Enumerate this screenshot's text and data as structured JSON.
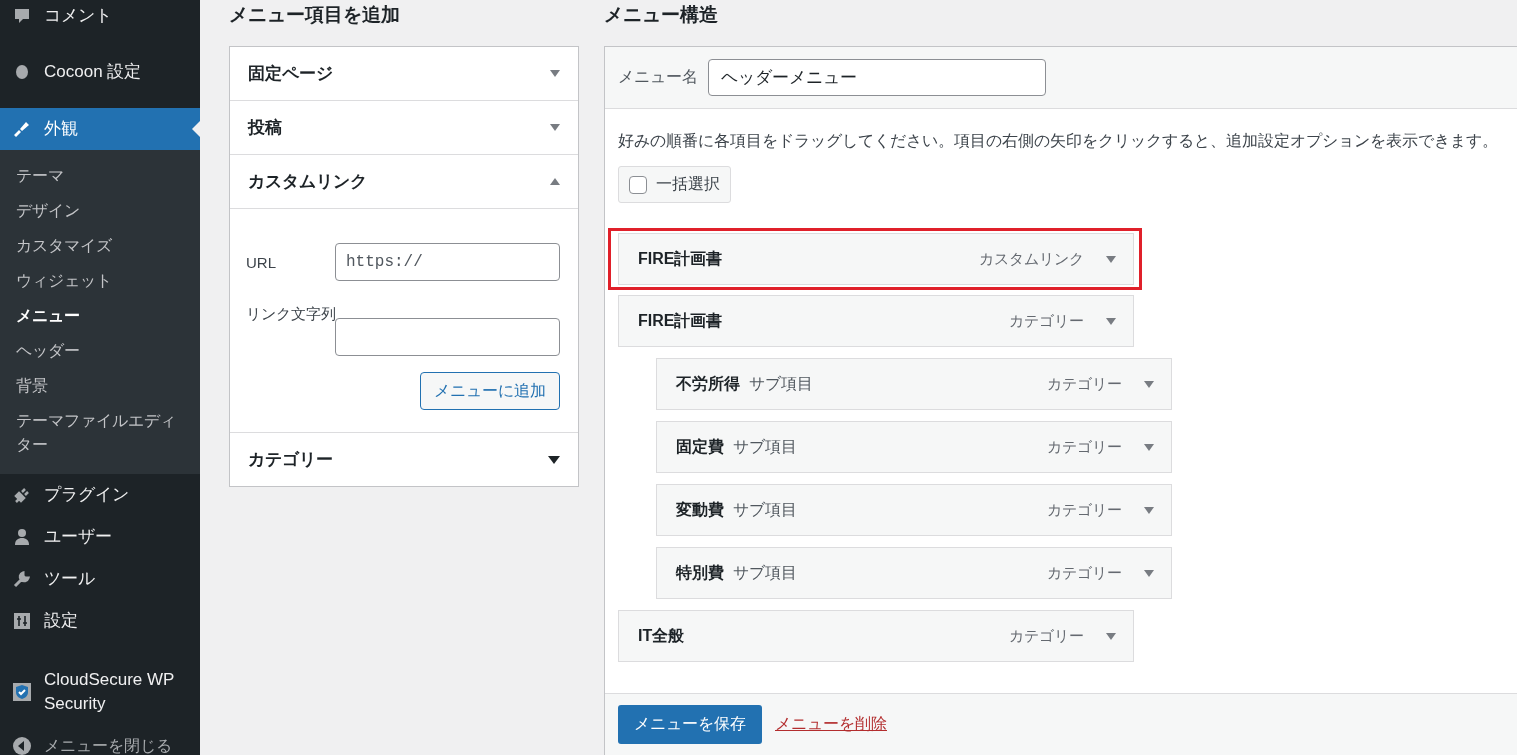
{
  "sidebar": {
    "items": [
      {
        "label": "コメント",
        "selected": false
      },
      {
        "label": "Cocoon 設定",
        "selected": false
      },
      {
        "label": "外観",
        "selected": true,
        "children": [
          {
            "label": "テーマ",
            "selected": false
          },
          {
            "label": "デザイン",
            "selected": false
          },
          {
            "label": "カスタマイズ",
            "selected": false
          },
          {
            "label": "ウィジェット",
            "selected": false
          },
          {
            "label": "メニュー",
            "selected": true
          },
          {
            "label": "ヘッダー",
            "selected": false
          },
          {
            "label": "背景",
            "selected": false
          },
          {
            "label": "テーマファイルエディター",
            "selected": false
          }
        ]
      },
      {
        "label": "プラグイン",
        "selected": false
      },
      {
        "label": "ユーザー",
        "selected": false
      },
      {
        "label": "ツール",
        "selected": false
      },
      {
        "label": "設定",
        "selected": false
      },
      {
        "label": "CloudSecure WP Security",
        "selected": false
      }
    ],
    "collapse": "メニューを閉じる"
  },
  "add_items": {
    "title": "メニュー項目を追加",
    "sections": [
      {
        "title": "固定ページ",
        "expanded": false
      },
      {
        "title": "投稿",
        "expanded": false
      },
      {
        "title": "カスタムリンク",
        "expanded": true,
        "url_label": "URL",
        "url_placeholder": "https://",
        "text_label": "リンク文字列",
        "button": "メニューに追加"
      },
      {
        "title": "カテゴリー",
        "expanded": false
      }
    ]
  },
  "structure": {
    "title": "メニュー構造",
    "name_label": "メニュー名",
    "name_value": "ヘッダーメニュー",
    "instructions": "好みの順番に各項目をドラッグしてください。項目の右側の矢印をクリックすると、追加設定オプションを表示できます。",
    "bulk_select": {
      "label": "一括選択",
      "checked": false
    },
    "items": [
      {
        "title": "FIRE計画書",
        "type": "カスタムリンク",
        "highlighted": true
      },
      {
        "title": "FIRE計画書",
        "type": "カテゴリー",
        "highlighted": false,
        "children": [
          {
            "title": "不労所得",
            "sub_label": "サブ項目",
            "type": "カテゴリー",
            "highlighted": false
          },
          {
            "title": "固定費",
            "sub_label": "サブ項目",
            "type": "カテゴリー",
            "highlighted": false
          },
          {
            "title": "変動費",
            "sub_label": "サブ項目",
            "type": "カテゴリー",
            "highlighted": false
          },
          {
            "title": "特別費",
            "sub_label": "サブ項目",
            "type": "カテゴリー",
            "highlighted": false
          }
        ]
      },
      {
        "title": "IT全般",
        "type": "カテゴリー",
        "highlighted": false
      }
    ],
    "save_button": "メニューを保存",
    "delete_link": "メニューを削除"
  }
}
